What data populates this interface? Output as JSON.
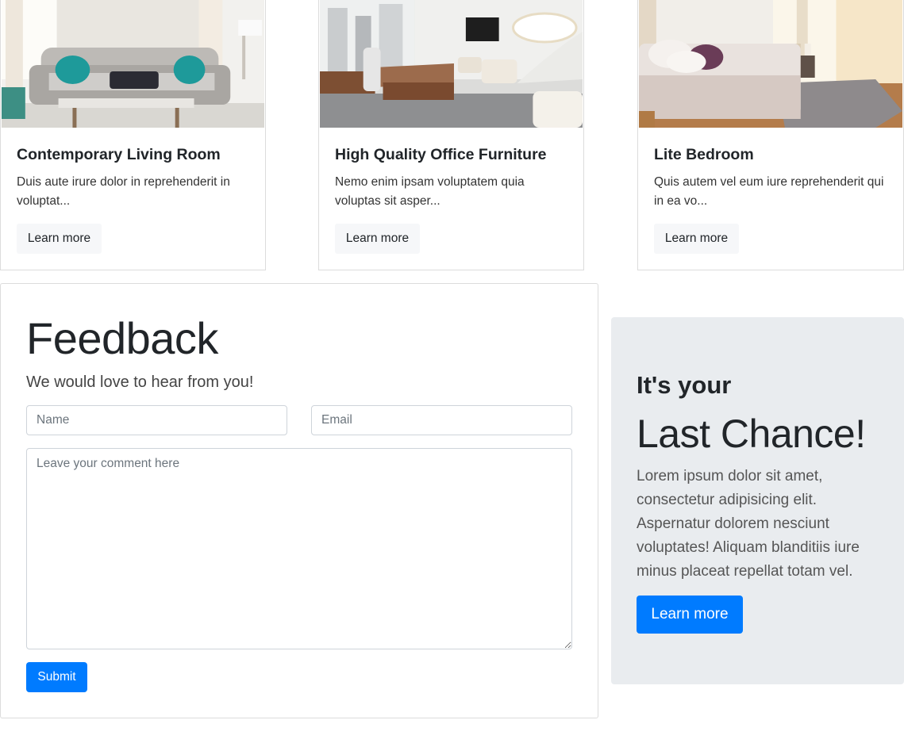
{
  "cards": [
    {
      "title": "Contemporary Living Room",
      "text": "Duis aute irure dolor in reprehenderit in voluptat...",
      "button_label": "Learn more"
    },
    {
      "title": "High Quality Office Furniture",
      "text": "Nemo enim ipsam voluptatem quia voluptas sit asper...",
      "button_label": "Learn more"
    },
    {
      "title": "Lite Bedroom",
      "text": "Quis autem vel eum iure reprehenderit qui in ea vo...",
      "button_label": "Learn more"
    }
  ],
  "feedback": {
    "title": "Feedback",
    "subtitle": "We would love to hear from you!",
    "name_placeholder": "Name",
    "email_placeholder": "Email",
    "comment_placeholder": "Leave your comment here",
    "submit_label": "Submit"
  },
  "promo": {
    "kicker": "It's your",
    "headline": "Last Chance!",
    "text": "Lorem ipsum dolor sit amet, consectetur adipisicing elit. Aspernatur dolorem nesciunt voluptates! Aliquam blanditiis iure minus placeat repellat totam vel.",
    "button_label": "Learn more"
  },
  "colors": {
    "primary": "#007bff",
    "promo_background": "#e9ecef",
    "light_button": "#f6f7f9"
  }
}
